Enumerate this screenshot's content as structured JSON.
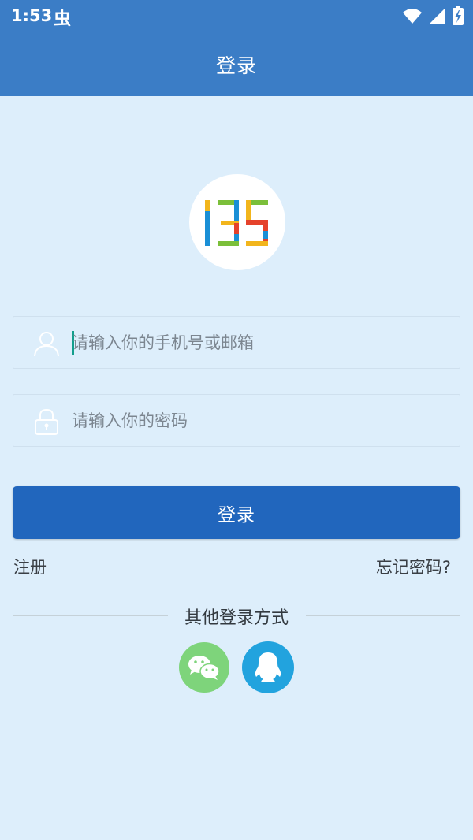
{
  "status_bar": {
    "time": "1:53",
    "indicator_glyph": "虫",
    "icons": [
      "wifi-icon",
      "signal-icon",
      "battery-charging-icon"
    ]
  },
  "header": {
    "title": "登录"
  },
  "logo": {
    "text": "135"
  },
  "form": {
    "phone_placeholder": "请输入你的手机号或邮箱",
    "phone_value": "",
    "password_placeholder": "请输入你的密码",
    "password_value": ""
  },
  "actions": {
    "login_label": "登录",
    "register_label": "注册",
    "forgot_label": "忘记密码?"
  },
  "other_login": {
    "title": "其他登录方式",
    "providers": [
      "wechat-icon",
      "qq-icon"
    ]
  },
  "colors": {
    "header": "#3b7dc6",
    "background": "#ddeefb",
    "primary_button": "#2166bd",
    "wechat": "#7ed47b",
    "qq": "#22a3de",
    "caret": "#139e8c"
  }
}
